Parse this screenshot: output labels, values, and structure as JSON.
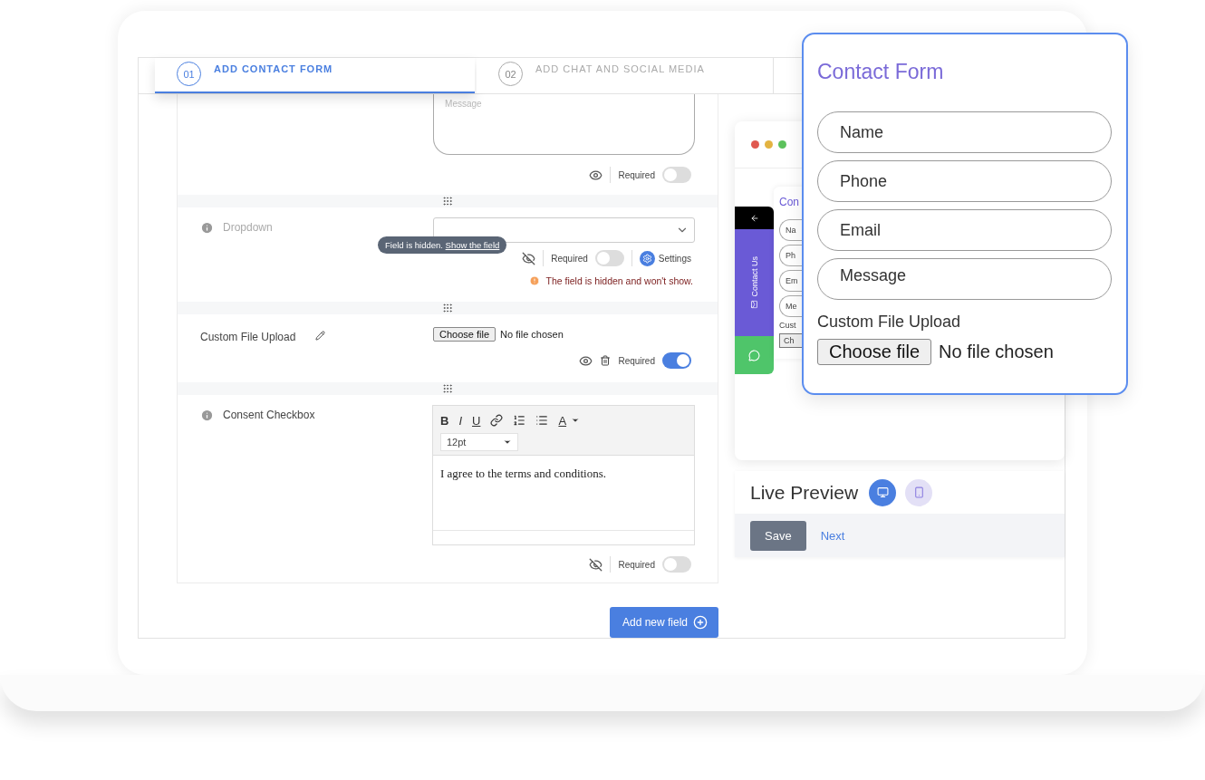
{
  "steps": [
    {
      "number": "01",
      "label": "ADD CONTACT FORM",
      "selected": true
    },
    {
      "number": "02",
      "label": "ADD CHAT AND SOCIAL MEDIA",
      "selected": false
    }
  ],
  "fields": [
    {
      "kind": "textarea",
      "placeholder": "Message",
      "visible": true,
      "required": false,
      "required_label": "Required"
    },
    {
      "kind": "select",
      "label": "Dropdown",
      "disabled": true,
      "visible": false,
      "required": false,
      "required_label": "Required",
      "settings_label": "Settings",
      "tooltip": {
        "text": "Field is hidden.",
        "link": "Show the field"
      },
      "warning": "The field is hidden and won't show."
    },
    {
      "kind": "file",
      "label": "Custom File Upload",
      "disabled": false,
      "button": "Choose file",
      "status": "No file chosen",
      "visible": true,
      "deletable": true,
      "required": true,
      "required_label": "Required"
    },
    {
      "kind": "editor",
      "label": "Consent Checkbox",
      "disabled": false,
      "toolbar": [
        {
          "kind": "bold",
          "label": "B"
        },
        {
          "kind": "italic",
          "label": "I"
        },
        {
          "kind": "underline",
          "label": "U"
        },
        {
          "kind": "link"
        },
        {
          "kind": "ordered-list"
        },
        {
          "kind": "bullet-list"
        },
        {
          "kind": "text-color",
          "label": "A"
        }
      ],
      "font_size": "12pt",
      "content": "I agree to the terms and conditions.",
      "visible": false,
      "required": false,
      "required_label": "Required"
    }
  ],
  "add_button": "Add new field",
  "preview": {
    "side_tab": {
      "label": "Contact Us"
    },
    "mini_form": {
      "title": "Con",
      "fields": [
        "Na",
        "Ph",
        "Em",
        "Me"
      ],
      "upload_label": "Cust",
      "button": "Ch"
    }
  },
  "live_preview": {
    "title": "Live Preview",
    "devices": [
      {
        "kind": "desktop",
        "selected": true
      },
      {
        "kind": "mobile",
        "selected": false
      }
    ],
    "save": "Save",
    "next": "Next"
  },
  "popup": {
    "title": "Contact Form",
    "fields": [
      {
        "kind": "input",
        "placeholder": "Name"
      },
      {
        "kind": "input",
        "placeholder": "Phone"
      },
      {
        "kind": "input",
        "placeholder": "Email"
      },
      {
        "kind": "textarea",
        "placeholder": "Message"
      }
    ],
    "upload_label": "Custom File Upload",
    "button": "Choose file",
    "status": "No file chosen"
  }
}
